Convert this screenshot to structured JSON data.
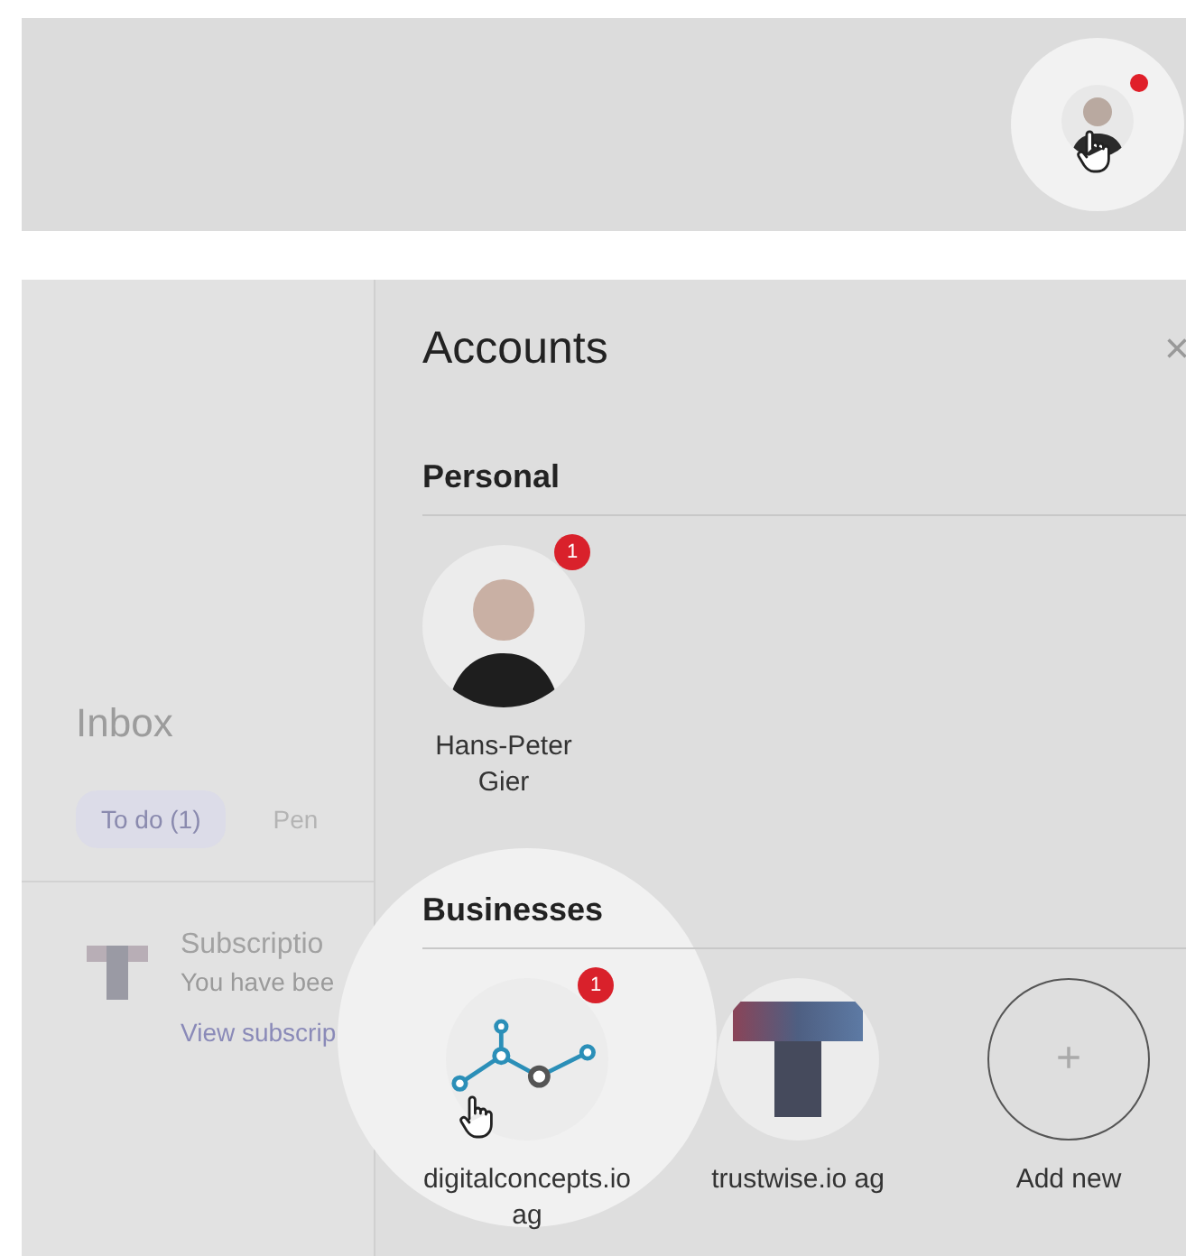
{
  "top_bar": {
    "avatar_notification": true,
    "spotlight": true
  },
  "inbox": {
    "title": "Inbox",
    "tabs": [
      {
        "label": "To do (1)",
        "selected": true
      },
      {
        "label": "Pen",
        "selected": false
      }
    ],
    "items": [
      {
        "title": "Subscriptio",
        "text": "You have bee",
        "link": "View subscrip"
      }
    ]
  },
  "accounts": {
    "title": "Accounts",
    "close": "×",
    "sections": [
      {
        "title": "Personal",
        "accounts": [
          {
            "kind": "person",
            "name": "Hans-Peter Gier",
            "badge": "1",
            "highlighted": false
          }
        ]
      },
      {
        "title": "Businesses",
        "accounts": [
          {
            "kind": "network-logo",
            "name": "digitalconcepts.io ag",
            "badge": "1",
            "highlighted": true
          },
          {
            "kind": "t-logo",
            "name": "trustwise.io ag",
            "highlighted": false
          },
          {
            "kind": "add",
            "name": "Add new",
            "icon": "+",
            "highlighted": false
          }
        ]
      }
    ]
  }
}
